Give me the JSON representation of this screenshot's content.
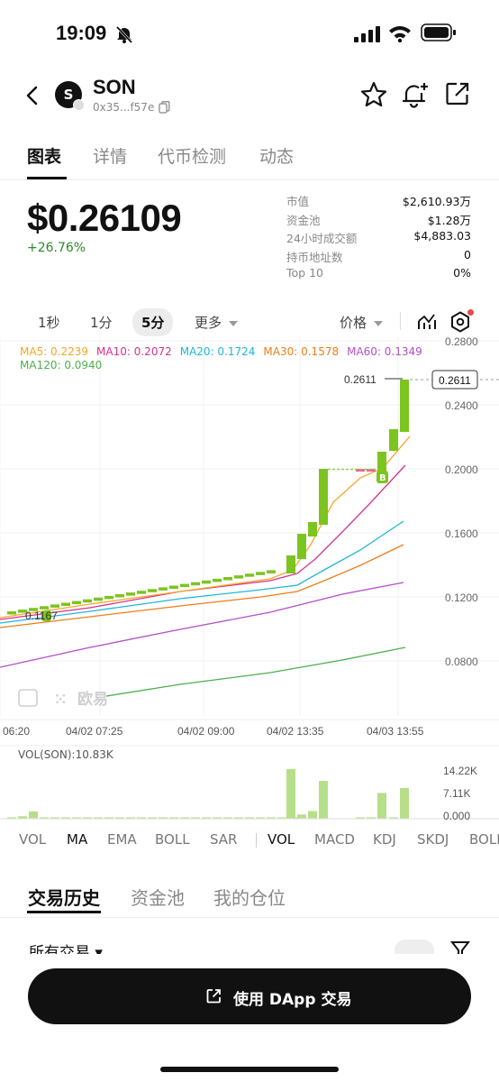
{
  "status": {
    "time": "19:09"
  },
  "token": {
    "name": "SON",
    "avatar_letter": "S",
    "address": "0x35...f57e"
  },
  "tabs": [
    "图表",
    "详情",
    "代币检测",
    "动态"
  ],
  "price": {
    "value": "$0.26109",
    "change": "+26.76%"
  },
  "stats": [
    {
      "k": "市值",
      "v": "$2,610.93万"
    },
    {
      "k": "资金池",
      "v": "$1.28万"
    },
    {
      "k": "24小时成交额",
      "v": "$4,883.03"
    },
    {
      "k": "持币地址数",
      "v": "0"
    },
    {
      "k": "Top 10",
      "v": "0%"
    }
  ],
  "intervals": {
    "items": [
      "1秒",
      "1分",
      "5分"
    ],
    "active": "5分",
    "more": "更多",
    "price_label": "价格"
  },
  "ma_legend": [
    {
      "label": "MA5: 0.2239",
      "color": "#f5a623"
    },
    {
      "label": "MA10: 0.2072",
      "color": "#d6338f"
    },
    {
      "label": "MA20: 0.1724",
      "color": "#1fb6d8"
    },
    {
      "label": "MA30: 0.1578",
      "color": "#ef7d1a"
    },
    {
      "label": "MA60: 0.1349",
      "color": "#b34fc9"
    },
    {
      "label": "MA120: 0.0940",
      "color": "#4caf50"
    }
  ],
  "chart_data": {
    "type": "candlestick",
    "y_ticks": [
      "0.2800",
      "0.2400",
      "0.2000",
      "0.1600",
      "0.1200",
      "0.0800"
    ],
    "x_ticks": [
      "06:20",
      "04/02 07:25",
      "04/02 09:00",
      "04/02 13:35",
      "04/03 13:55"
    ],
    "current_price_label": "0.2611",
    "high_label": "0.2611",
    "low_label": "0.1167",
    "buy_marker": "B",
    "watermark": "欧易",
    "up_color": "#7cc41f",
    "down_color": "#f0609a"
  },
  "volume": {
    "label": "VOL(SON):10.83K",
    "ticks": [
      "14.22K",
      "7.11K",
      "0.000"
    ],
    "values": [
      0.4,
      0.7,
      2.1,
      0.3,
      0.2,
      0.2,
      0.2,
      0.2,
      0.2,
      0.2,
      0.2,
      0.2,
      0.2,
      0.2,
      0.2,
      0.2,
      0.2,
      0.2,
      0.2,
      0.2,
      0.2,
      0.2,
      0.2,
      0.2,
      0.2,
      0.3,
      0.3,
      14.22,
      1.2,
      2.2,
      10.83,
      0.2,
      0.2,
      7.4,
      0.2,
      8.8
    ]
  },
  "indicator_tabs": [
    "VOL",
    "MA",
    "EMA",
    "BOLL",
    "SAR",
    "VOL",
    "MACD",
    "KDJ",
    "SKDJ",
    "BOLL"
  ],
  "section_tabs": [
    "交易历史",
    "资金池",
    "我的仓位"
  ],
  "filter": {
    "label": "所有交易"
  },
  "dapp_button": "使用 DApp 交易"
}
